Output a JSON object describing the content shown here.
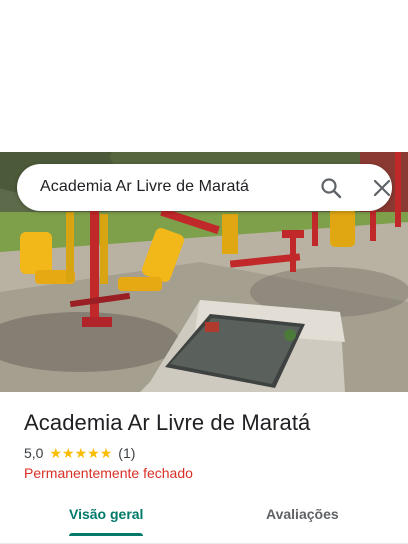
{
  "search": {
    "query": "Academia Ar Livre de Maratá",
    "search_icon": "search-icon",
    "close_icon": "close-icon"
  },
  "place": {
    "name": "Academia Ar Livre de Maratá",
    "rating": "5,0",
    "rating_stars": 5,
    "review_count": "(1)",
    "status": "Permanentemente fechado",
    "photo": "outdoor-gym-photo"
  },
  "tabs": [
    {
      "label": "Visão geral",
      "active": true
    },
    {
      "label": "Avaliações",
      "active": false
    }
  ],
  "colors": {
    "accent": "#00796b",
    "closed": "#d93025",
    "star": "#fbbc04"
  }
}
